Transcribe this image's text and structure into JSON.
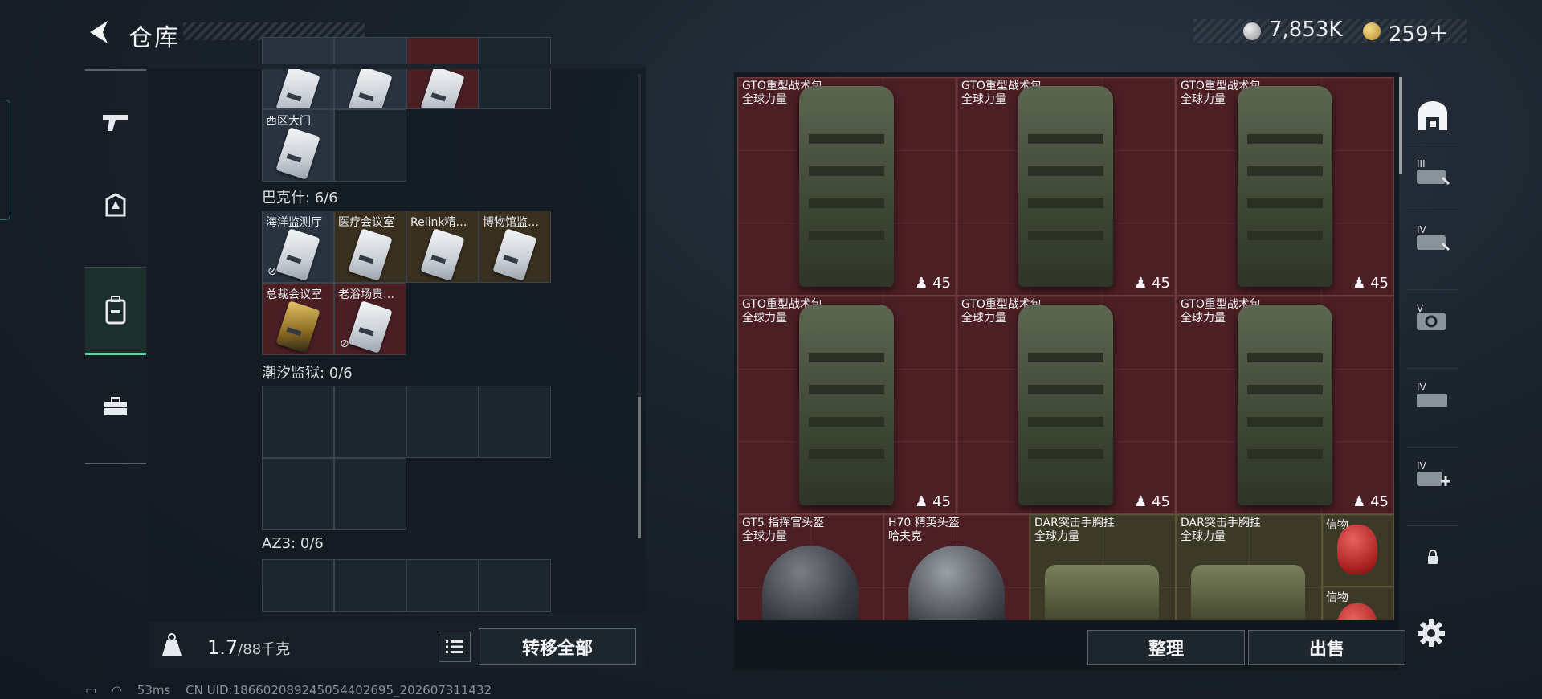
{
  "header": {
    "title": "仓库",
    "back_icon": "back-arrow-icon"
  },
  "currency": {
    "silver": "7,853K",
    "gold": "259＋"
  },
  "left_nav": {
    "items": [
      "weapons",
      "equipment",
      "container",
      "toolbox"
    ],
    "active": "container"
  },
  "keycards": {
    "top_row": [
      "",
      "",
      "",
      ""
    ],
    "west_gate": {
      "label": "西区大门"
    },
    "groups": [
      {
        "label": "巴克什: 6/6",
        "cards": [
          {
            "name": "海洋监测厅",
            "style": "blue",
            "unavailable": true
          },
          {
            "name": "医疗会议室",
            "style": "gold"
          },
          {
            "name": "Relink精…",
            "style": "gold"
          },
          {
            "name": "博物馆监…",
            "style": "gold"
          },
          {
            "name": "总裁会议室",
            "style": "red",
            "gold_card": true
          },
          {
            "name": "老浴场贵…",
            "style": "red",
            "unavailable": true
          }
        ]
      },
      {
        "label": "潮汐监狱: 0/6"
      },
      {
        "label": "AZ3: 0/6"
      }
    ]
  },
  "weight": {
    "current": "1.7",
    "max": "/88千克"
  },
  "buttons": {
    "transfer_all": "转移全部",
    "organize": "整理",
    "sell": "出售"
  },
  "items": {
    "backpacks": [
      {
        "name": "GTO重型战术包",
        "sub": "全球力量",
        "qty": "45"
      },
      {
        "name": "GTO重型战术包",
        "sub": "全球力量",
        "qty": "45"
      },
      {
        "name": "GTO重型战术包",
        "sub": "全球力量",
        "qty": "45"
      },
      {
        "name": "GTO重型战术包",
        "sub": "全球力量",
        "qty": "45"
      },
      {
        "name": "GTO重型战术包",
        "sub": "全球力量",
        "qty": "45"
      },
      {
        "name": "GTO重型战术包",
        "sub": "全球力量",
        "qty": "45"
      }
    ],
    "bottom": [
      {
        "name": "GT5 指挥官头盔",
        "sub": "全球力量"
      },
      {
        "name": "H70 精英头盔",
        "sub": "哈夫克"
      },
      {
        "name": "DAR突击手胸挂",
        "sub": "全球力量"
      },
      {
        "name": "DAR突击手胸挂",
        "sub": "全球力量"
      }
    ],
    "relic_1": "信物",
    "relic_2": "信物"
  },
  "right_tabs": [
    "container-icon",
    "III",
    "IV",
    "V",
    "IV",
    "IV",
    "lock-icon"
  ],
  "status": {
    "ping": "53ms",
    "uid": "CN UID:18660208924505440269​5_202607311432"
  },
  "colors": {
    "accent": "#5fd1a0",
    "item_red": "#4b1f24",
    "item_olive": "#3c3a27"
  }
}
